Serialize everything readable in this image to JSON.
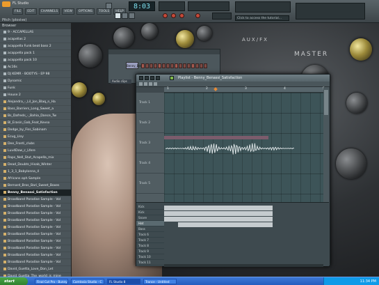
{
  "app": {
    "title": "FL Studio",
    "hint": "Pitch (plosive)",
    "time": "8:03",
    "cpu_label": "Click to access the tutorial..."
  },
  "menu": [
    "FILE",
    "EDIT",
    "CHANNELS",
    "VIEW",
    "OPTIONS",
    "TOOLS",
    "HELP"
  ],
  "browser": {
    "header": "Browser",
    "items": [
      {
        "label": "9 - ACCAPELLAS",
        "type": "folder"
      },
      {
        "label": "acapellas 2",
        "type": "folder"
      },
      {
        "label": "acappella Funk beat bass 2",
        "type": "folder"
      },
      {
        "label": "acappella pack 1",
        "type": "folder"
      },
      {
        "label": "acappella pack 10",
        "type": "folder"
      },
      {
        "label": "Ac16s",
        "type": "folder"
      },
      {
        "label": "DJ KEMR - BOOTYS - EP 98",
        "type": "folder"
      },
      {
        "label": "Dynamic",
        "type": "folder"
      },
      {
        "label": "Funk",
        "type": "folder"
      },
      {
        "label": "House 2",
        "type": "folder"
      },
      {
        "label": "Alejandra_-_Lil_Jon_Blaq_n_Ha",
        "type": "file"
      },
      {
        "label": "Bass_Barriers_Long_Sweet_a",
        "type": "file"
      },
      {
        "label": "Bs_Dafreds_-_Bahia_Dance_Tw",
        "type": "file"
      },
      {
        "label": "Bl_Erasin_Gab_Feat_Kevso",
        "type": "file"
      },
      {
        "label": "Dodge_by_Fiss_Sabinam",
        "type": "file"
      },
      {
        "label": "Ecug_Lloy",
        "type": "file"
      },
      {
        "label": "Dee_Fronti_clubs",
        "type": "file"
      },
      {
        "label": "Luv4Dow_c_Lfere",
        "type": "file"
      },
      {
        "label": "Raps_Nell_Stut_Acapella_mix",
        "type": "file"
      },
      {
        "label": "Dead_Doubts_Hisab_Winter",
        "type": "file"
      },
      {
        "label": "1_3_1_Babylonna_4",
        "type": "file"
      },
      {
        "label": "Africans oph Sample",
        "type": "file"
      },
      {
        "label": "Bernard_Bros_Bari_Sweet_Boxes",
        "type": "file"
      },
      {
        "label": "Benny_Benassi_Satisfaction",
        "type": "file"
      },
      {
        "label": "Broadband Paradise Sample - Vol",
        "type": "file"
      },
      {
        "label": "Broadband Paradise Sample - Vol",
        "type": "file"
      },
      {
        "label": "Broadband Paradise Sample - Vol",
        "type": "file"
      },
      {
        "label": "Broadband Paradise Sample - Vol",
        "type": "file"
      },
      {
        "label": "Broadband Paradise Sample - Vol",
        "type": "file"
      },
      {
        "label": "Broadband Paradise Sample - Vol",
        "type": "file"
      },
      {
        "label": "Broadband Paradise Sample - Vol",
        "type": "file"
      },
      {
        "label": "Broadband Paradise Sample - Vol",
        "type": "file"
      },
      {
        "label": "Broadband Paradise Sample - Vol",
        "type": "file"
      },
      {
        "label": "Broadband Paradise Sample - Vol",
        "type": "file"
      },
      {
        "label": "David_Guetta_Love_Don_Let",
        "type": "file"
      },
      {
        "label": "David_Guetta_The_world_is_mine",
        "type": "file"
      },
      {
        "label": "DJ_Antoine_Ins_02",
        "type": "file"
      }
    ],
    "selected_index": 23
  },
  "rack": {
    "channel_label": "Benny_Ben",
    "row_label": "Audio clips"
  },
  "playlist": {
    "title": "Playlist - Benny_Benassi_Satisfaction",
    "ruler": [
      "1",
      "2",
      "3",
      "4",
      "5"
    ],
    "tracks": [
      "Track 1",
      "Track 2",
      "Track 3",
      "Track 4",
      "Track 5"
    ],
    "bottom_rows": [
      "Kick",
      "Kick",
      "Snare",
      "Hat",
      "Bass",
      "Track 6",
      "Track 7",
      "Track 8",
      "Track 9",
      "Track 10",
      "Track 11"
    ],
    "active_row": 3
  },
  "wallpaper": {
    "text": "MASTER",
    "text2": "AUX/FX"
  },
  "taskbar": {
    "start": "start",
    "tasks": [
      "Final Cut Pro - Bunny",
      "Camtasia Studio - C",
      "FL Studio 8",
      "Trance - Untitled"
    ],
    "clock": "11:34 PM"
  },
  "colors": {
    "accent": "#e88a35",
    "clip_color": "#7c5c6c",
    "time_color": "#7ee2f0"
  }
}
